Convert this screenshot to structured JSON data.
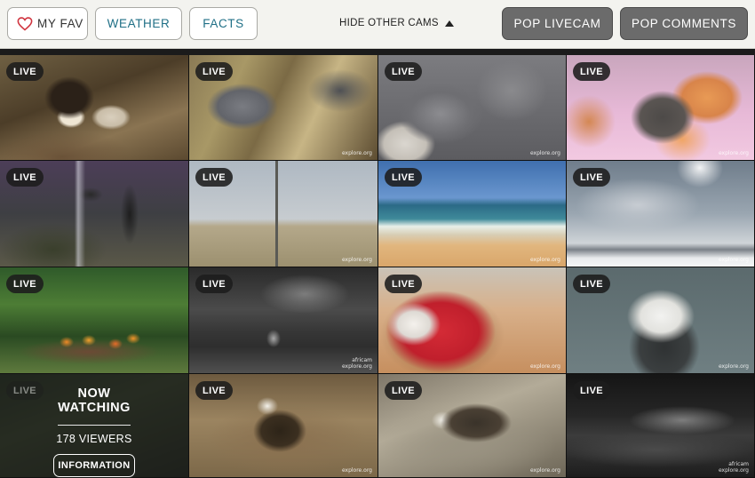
{
  "topbar": {
    "fav_label": "MY FAV",
    "weather_label": "WEATHER",
    "facts_label": "FACTS",
    "hide_label": "HIDE OTHER CAMS",
    "pop_livecam_label": "POP LIVECAM",
    "pop_comments_label": "POP COMMENTS"
  },
  "live_badge": "LIVE",
  "watermarks": {
    "explore": "explore.org",
    "africam": "africam\nexplore.org"
  },
  "now_watching": {
    "badge": "LIVE",
    "title_line1": "NOW",
    "title_line2": "WATCHING",
    "viewers": "178 VIEWERS",
    "info_label": "INFORMATION"
  },
  "tiles": [
    {
      "name": "cam-eagle-nest-chick",
      "scene": "bald eagle with chicks on nest"
    },
    {
      "name": "cam-nest-fluffy-chick",
      "scene": "fluffy owlet in nest"
    },
    {
      "name": "cam-puppies-sleeping",
      "scene": "sleeping grey puppies"
    },
    {
      "name": "cam-kittens",
      "scene": "kittens on pink blanket"
    },
    {
      "name": "cam-aquarium-diver",
      "scene": "diver in kelp aquarium"
    },
    {
      "name": "cam-osprey-pole",
      "scene": "pole in marsh"
    },
    {
      "name": "cam-beach",
      "scene": "beach with waves"
    },
    {
      "name": "cam-snow-town",
      "scene": "snowy town sky"
    },
    {
      "name": "cam-jungle-feeder",
      "scene": "tropical feeder with fruit"
    },
    {
      "name": "cam-africam-night",
      "scene": "night waterhole"
    },
    {
      "name": "cam-dog-bed",
      "scene": "dalmatian puppies on red bed"
    },
    {
      "name": "cam-eagle-closeup",
      "scene": "eagle close-up"
    },
    {
      "name": "cam-bald-eagle-nest",
      "scene": "bald eagle on nest"
    },
    {
      "name": "cam-osprey-nest",
      "scene": "osprey on stick nest"
    },
    {
      "name": "cam-africam-night-2",
      "scene": "night savanna"
    }
  ]
}
